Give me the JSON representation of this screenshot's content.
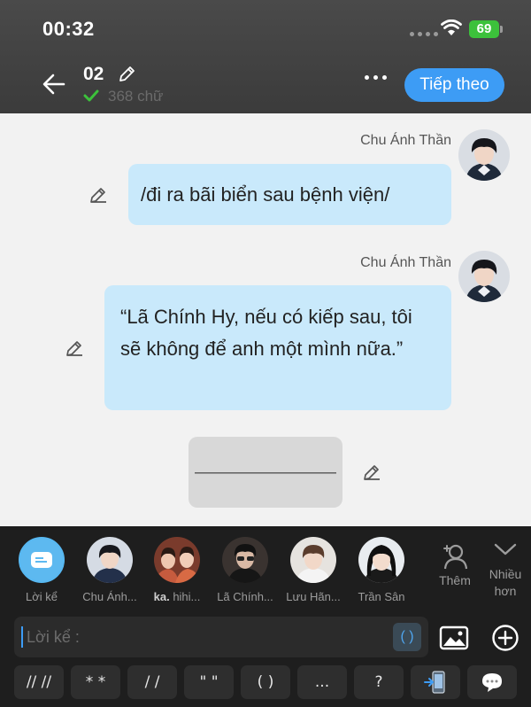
{
  "status_bar": {
    "time": "00:32",
    "battery": "69"
  },
  "header": {
    "chapter_title": "02",
    "word_count": "368 chữ",
    "next_label": "Tiếp theo"
  },
  "messages": [
    {
      "sender": "Chu Ánh Thần",
      "text": "/đi ra bãi biển sau bệnh viện/"
    },
    {
      "sender": "Chu Ánh Thần",
      "text": "“Lã Chính Hy, nếu có kiếp sau, tôi sẽ không để anh một mình nữa.”"
    },
    {
      "sender": "",
      "text": "————————"
    }
  ],
  "characters": [
    {
      "name": "Lời kể"
    },
    {
      "name": "Chu Ánh..."
    },
    {
      "name_bold": "ka.",
      "name": "hihi..."
    },
    {
      "name": "Lã Chính..."
    },
    {
      "name": "Lưu Hãn..."
    },
    {
      "name": "Trần Sân"
    }
  ],
  "side_buttons": {
    "add_label": "Thêm",
    "more_label": "Nhiều hơn"
  },
  "composer": {
    "placeholder": "Lời kể :",
    "paren_label": "( )"
  },
  "quick_keys": [
    "// //",
    "* *",
    "/ /",
    "\" \"",
    "( )",
    "...",
    "?",
    "phone-arrow-icon",
    "chat-bubble-icon"
  ],
  "colors": {
    "accent": "#3d9cf5",
    "bubble": "#c9e9fb",
    "battery": "#3cc13b"
  }
}
